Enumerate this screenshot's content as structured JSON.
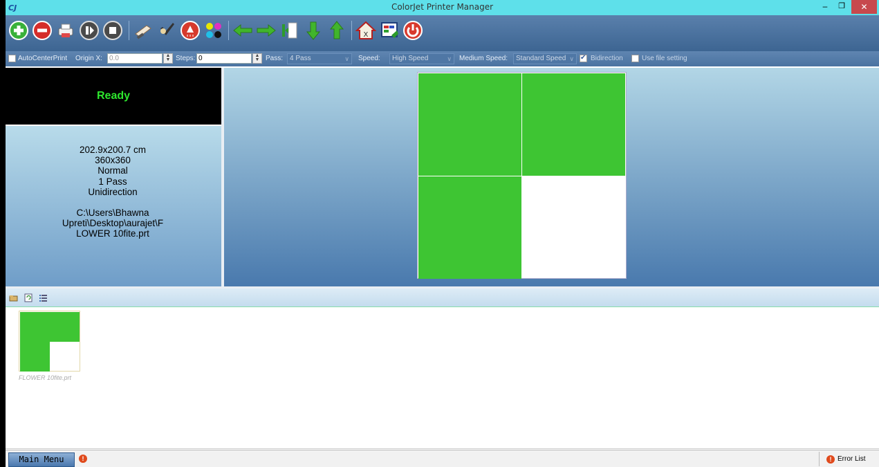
{
  "window": {
    "title": "ColorJet  Printer Manager",
    "app_icon_label": "CJ"
  },
  "toolbar": {
    "buttons": [
      {
        "name": "add",
        "icon": "add-circle-icon",
        "color": "#3cb43c"
      },
      {
        "name": "remove",
        "icon": "remove-circle-icon",
        "color": "#d8322c"
      },
      {
        "name": "print",
        "icon": "printer-icon"
      },
      {
        "name": "pause",
        "icon": "pause-icon"
      },
      {
        "name": "stop",
        "icon": "stop-icon"
      },
      {
        "name": "clean",
        "icon": "brush-icon"
      },
      {
        "name": "check",
        "icon": "nozzle-check-icon"
      },
      {
        "name": "spray",
        "icon": "spray-icon"
      },
      {
        "name": "colors",
        "icon": "cmyk-dots-icon"
      },
      {
        "name": "move-left",
        "icon": "arrow-left-icon"
      },
      {
        "name": "move-right",
        "icon": "arrow-right-icon"
      },
      {
        "name": "origin",
        "icon": "origin-icon"
      },
      {
        "name": "move-down",
        "icon": "arrow-down-icon"
      },
      {
        "name": "move-up",
        "icon": "arrow-up-icon"
      },
      {
        "name": "home",
        "icon": "home-icon"
      },
      {
        "name": "settings",
        "icon": "calibration-icon"
      },
      {
        "name": "power",
        "icon": "power-icon"
      }
    ]
  },
  "options": {
    "auto_center_label": "AutoCenterPrint",
    "auto_center_checked": false,
    "origin_x_label": "Origin X:",
    "origin_x_value": "0.0",
    "steps_label": "Steps:",
    "steps_value": "0",
    "pass_label": "Pass:",
    "pass_value": "4 Pass",
    "speed_label": "Speed:",
    "speed_value": "High Speed",
    "medium_speed_label": "Medium Speed:",
    "medium_speed_value": "Standard Speed",
    "bidirection_label": "Bidirection",
    "bidirection_checked": true,
    "use_file_setting_label": "Use file setting",
    "use_file_setting_checked": false
  },
  "status": {
    "text": "Ready",
    "color": "#2ee62e"
  },
  "job_info": {
    "size": "202.9x200.7 cm",
    "resolution": "360x360",
    "mode": "Normal",
    "pass": "1 Pass",
    "direction": "Unidirection",
    "path_line1": "C:\\Users\\Bhawna",
    "path_line2": "Upreti\\Desktop\\aurajet\\F",
    "path_line3": "LOWER 10fite.prt"
  },
  "file_list": {
    "items": [
      {
        "label": "FLOWER 10fite.prt"
      }
    ]
  },
  "bottom": {
    "main_menu_label": "Main Menu",
    "error_list_label": "Error List"
  }
}
